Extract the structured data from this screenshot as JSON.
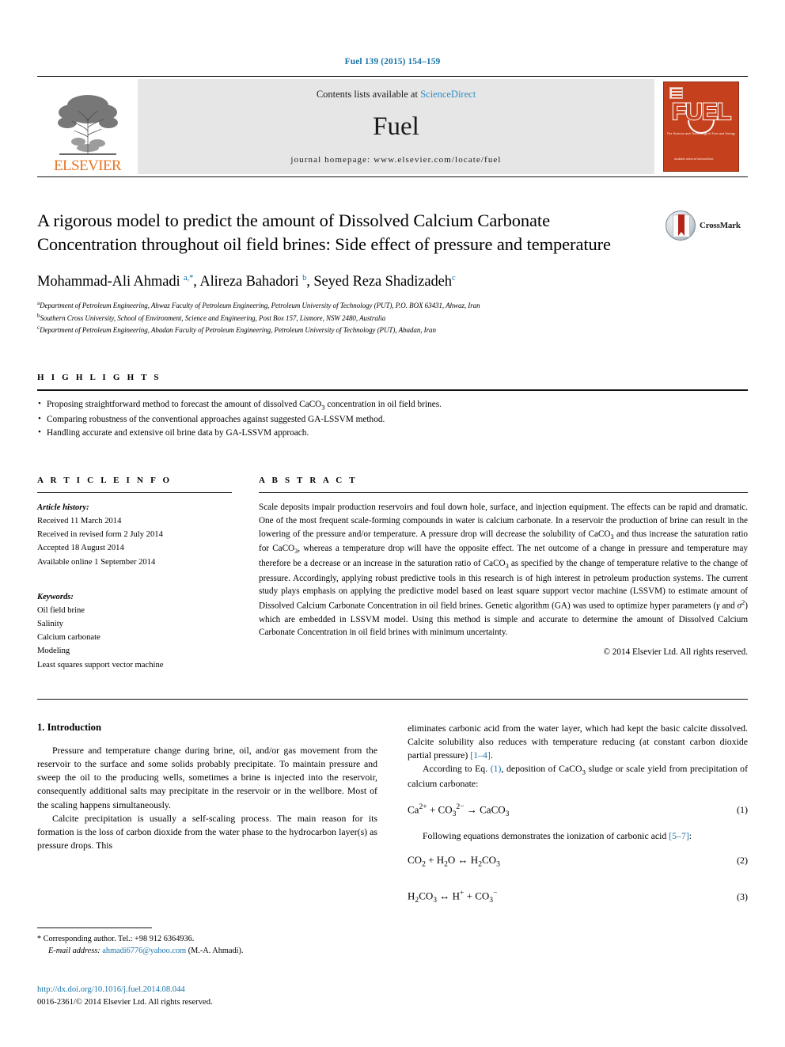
{
  "running_head": "Fuel 139 (2015) 154–159",
  "masthead": {
    "publisher_name": "ELSEVIER",
    "contents_prefix": "Contents lists available at ",
    "contents_link": "ScienceDirect",
    "journal_title": "Fuel",
    "homepage_line": "journal homepage: www.elsevier.com/locate/fuel",
    "cover_title": "FUEL",
    "cover_subtitle": "The Science and Technology of Fuel and Energy",
    "cover_footer": "Available online at\nScienceDirect"
  },
  "article": {
    "title": "A rigorous model to predict the amount of Dissolved Calcium Carbonate Concentration throughout oil field brines: Side effect of pressure and temperature",
    "crossmark_label": "CrossMark",
    "authors_html": "Mohammad-Ali Ahmadi <sup>a,*</sup>, Alireza Bahadori <sup>b</sup>, Seyed Reza Shadizadeh<sup>c</sup>",
    "affiliations": [
      {
        "marker": "a",
        "text": "Department of Petroleum Engineering, Ahwaz Faculty of Petroleum Engineering, Petroleum University of Technology (PUT), P.O. BOX 63431, Ahwaz, Iran"
      },
      {
        "marker": "b",
        "text": "Southern Cross University, School of Environment, Science and Engineering, Post Box 157, Lismore, NSW 2480, Australia"
      },
      {
        "marker": "c",
        "text": "Department of Petroleum Engineering, Abadan Faculty of Petroleum Engineering, Petroleum University of Technology (PUT), Abadan, Iran"
      }
    ]
  },
  "highlights": {
    "heading": "H I G H L I G H T S",
    "items": [
      "Proposing straightforward method to forecast the amount of dissolved CaCO<sub>3</sub> concentration in oil field brines.",
      "Comparing robustness of the conventional approaches against suggested GA-LSSVM method.",
      "Handling accurate and extensive oil brine data by GA-LSSVM approach."
    ]
  },
  "article_info": {
    "heading": "A R T I C L E    I N F O",
    "history_label": "Article history:",
    "history": [
      "Received 11 March 2014",
      "Received in revised form 2 July 2014",
      "Accepted 18 August 2014",
      "Available online 1 September 2014"
    ],
    "keywords_label": "Keywords:",
    "keywords": [
      "Oil field brine",
      "Salinity",
      "Calcium carbonate",
      "Modeling",
      "Least squares support vector machine"
    ]
  },
  "abstract": {
    "heading": "A B S T R A C T",
    "text_html": "Scale deposits impair production reservoirs and foul down hole, surface, and injection equipment. The effects can be rapid and dramatic. One of the most frequent scale-forming compounds in water is calcium carbonate. In a reservoir the production of brine can result in the lowering of the pressure and/or temperature. A pressure drop will decrease the solubility of CaCO<sub>3</sub> and thus increase the saturation ratio for CaCO<sub>3</sub>, whereas a temperature drop will have the opposite effect. The net outcome of a change in pressure and temperature may therefore be a decrease or an increase in the saturation ratio of CaCO<sub>3</sub> as specified by the change of temperature relative to the change of pressure. Accordingly, applying robust predictive tools in this research is of high interest in petroleum production systems. The current study plays emphasis on applying the predictive model based on least square support vector machine (LSSVM) to estimate amount of Dissolved Calcium Carbonate Concentration in oil field brines. Genetic algorithm (GA) was used to optimize hyper parameters (<i>&#947;</i> and <i>&#963;</i><sup>2</sup>) which are embedded in LSSVM model. Using this method is simple and accurate to determine the amount of Dissolved Calcium Carbonate Concentration in oil field brines with minimum uncertainty.",
    "copyright": "© 2014 Elsevier Ltd. All rights reserved."
  },
  "body": {
    "section_heading": "1. Introduction",
    "left_paragraphs": [
      "Pressure and temperature change during brine, oil, and/or gas movement from the reservoir to the surface and some solids probably precipitate. To maintain pressure and sweep the oil to the producing wells, sometimes a brine is injected into the reservoir, consequently additional salts may precipitate in the reservoir or in the wellbore. Most of the scaling happens simultaneously.",
      "Calcite precipitation is usually a self-scaling process. The main reason for its formation is the loss of carbon dioxide from the water phase to the hydrocarbon layer(s) as pressure drops. This"
    ],
    "right_paragraph_1_html": "eliminates carbonic acid from the water layer, which had kept the basic calcite dissolved. Calcite solubility also reduces with temperature reducing (at constant carbon dioxide partial pressure) <a class=\"ref\" href=\"#\">[1–4]</a>.",
    "right_paragraph_2_html": "According to Eq. <a class=\"ref\" href=\"#\">(1)</a>, deposition of CaCO<sub>3</sub> sludge or scale yield from precipitation of calcium carbonate:",
    "right_paragraph_3_html": "Following equations demonstrates the ionization of carbonic acid <a class=\"ref\" href=\"#\">[5–7]</a>:",
    "equations": [
      {
        "body_html": "Ca<sup>2+</sup> + CO<sub>3</sub><sup>2&#8722;</sup> &#8594; CaCO<sub>3</sub>",
        "number": "(1)"
      },
      {
        "body_html": "CO<sub>2</sub> + H<sub>2</sub>O &#8596; H<sub>2</sub>CO<sub>3</sub>",
        "number": "(2)"
      },
      {
        "body_html": "H<sub>2</sub>CO<sub>3</sub> &#8596; H<sup>+</sup> + CO<sub>3</sub><sup>&#8722;</sup>",
        "number": "(3)"
      }
    ]
  },
  "footnote": {
    "corresponding_html": "<span class=\"star\">*</span> Corresponding author. Tel.: +98 912 6364936.",
    "email_label": "E-mail address:",
    "email": "ahmadi6776@yahoo.com",
    "email_owner": "(M.-A. Ahmadi)."
  },
  "footer": {
    "doi": "http://dx.doi.org/10.1016/j.fuel.2014.08.044",
    "issn_line": "0016-2361/© 2014 Elsevier Ltd. All rights reserved."
  },
  "colors": {
    "link": "#1a73a8",
    "elsevier_orange": "#E87424",
    "cover_orange": "#C5411E",
    "band_gray": "#e6e6e6"
  }
}
